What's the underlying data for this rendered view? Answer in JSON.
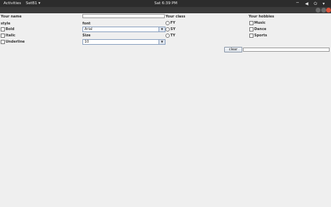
{
  "topbar": {
    "activities": "Activities",
    "app": "SetB1 ▾",
    "clock": "Sat  6:39 PM",
    "tray": "⌔ ◀ ⏻ ▾"
  },
  "form": {
    "name_label": "Your name",
    "name_value": "",
    "style_label": "style",
    "bold_label": "Bold",
    "italic_label": "Italic",
    "underline_label": "Underline",
    "font_label": "font",
    "font_value": "Arial",
    "size_label": "Size",
    "size_value": "10",
    "class_label": "Your class",
    "class_fy": "FY",
    "class_sy": "SY",
    "class_ty": "TY",
    "hobbies_label": "Your hobbies",
    "hobby_music": "Music",
    "hobby_dance": "Dance",
    "hobby_sports": "Sports",
    "clear_label": "clear",
    "output_value": ""
  },
  "icons": {
    "dropdown": "chevron-down-icon"
  },
  "colors": {
    "close_button": "#e0533a",
    "topbar": "#2c2c2c",
    "background": "#efefef"
  }
}
